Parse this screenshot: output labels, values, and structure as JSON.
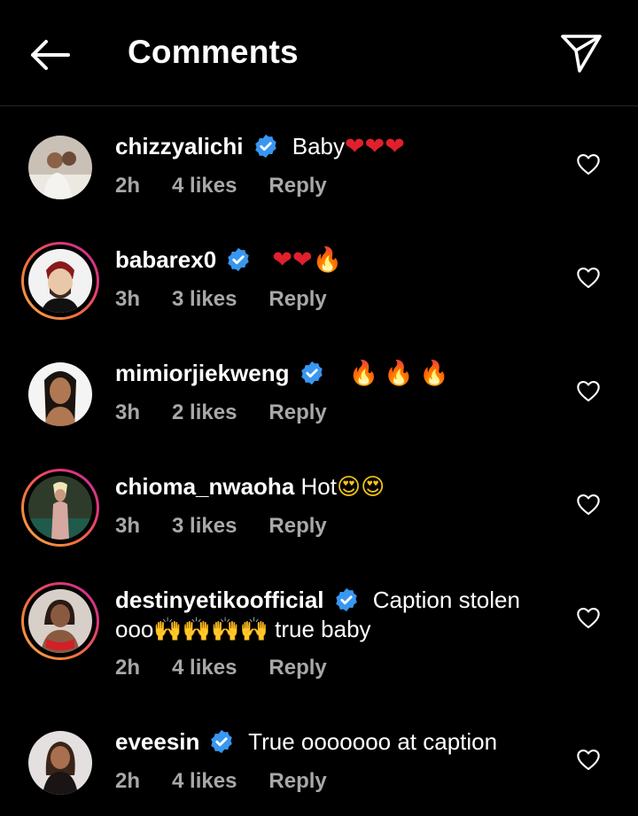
{
  "header": {
    "title": "Comments"
  },
  "comments": [
    {
      "username": "chizzyalichi",
      "verified": true,
      "text": "Baby",
      "emoji": "❤❤❤",
      "time": "2h",
      "likes": "4 likes",
      "reply": "Reply"
    },
    {
      "username": "babarex0",
      "verified": true,
      "text": "",
      "emoji": "❤❤🔥",
      "time": "3h",
      "likes": "3 likes",
      "reply": "Reply"
    },
    {
      "username": "mimiorjiekweng",
      "verified": true,
      "text": "",
      "emoji": "🔥🔥🔥",
      "time": "3h",
      "likes": "2 likes",
      "reply": "Reply"
    },
    {
      "username": "chioma_nwaoha",
      "verified": false,
      "text": "Hot",
      "emoji": "😍😍",
      "time": "3h",
      "likes": "3 likes",
      "reply": "Reply"
    },
    {
      "username": "destinyetikoofficial",
      "verified": true,
      "text": "Caption stolen ooo",
      "emoji": "🙌🙌🙌🙌",
      "text2": "true baby",
      "time": "2h",
      "likes": "4 likes",
      "reply": "Reply"
    },
    {
      "username": "eveesin",
      "verified": true,
      "text": "True ooooooo at caption",
      "emoji": "",
      "time": "2h",
      "likes": "4 likes",
      "reply": "Reply"
    }
  ],
  "colors": {
    "background": "#000000",
    "text": "#ffffff",
    "meta": "#a8a8a8",
    "verified": "#3897f0",
    "divider": "#262626"
  },
  "icons": {
    "back": "arrow-left-icon",
    "send": "paper-plane-icon",
    "verified": "verified-badge-icon",
    "like": "heart-outline-icon"
  }
}
